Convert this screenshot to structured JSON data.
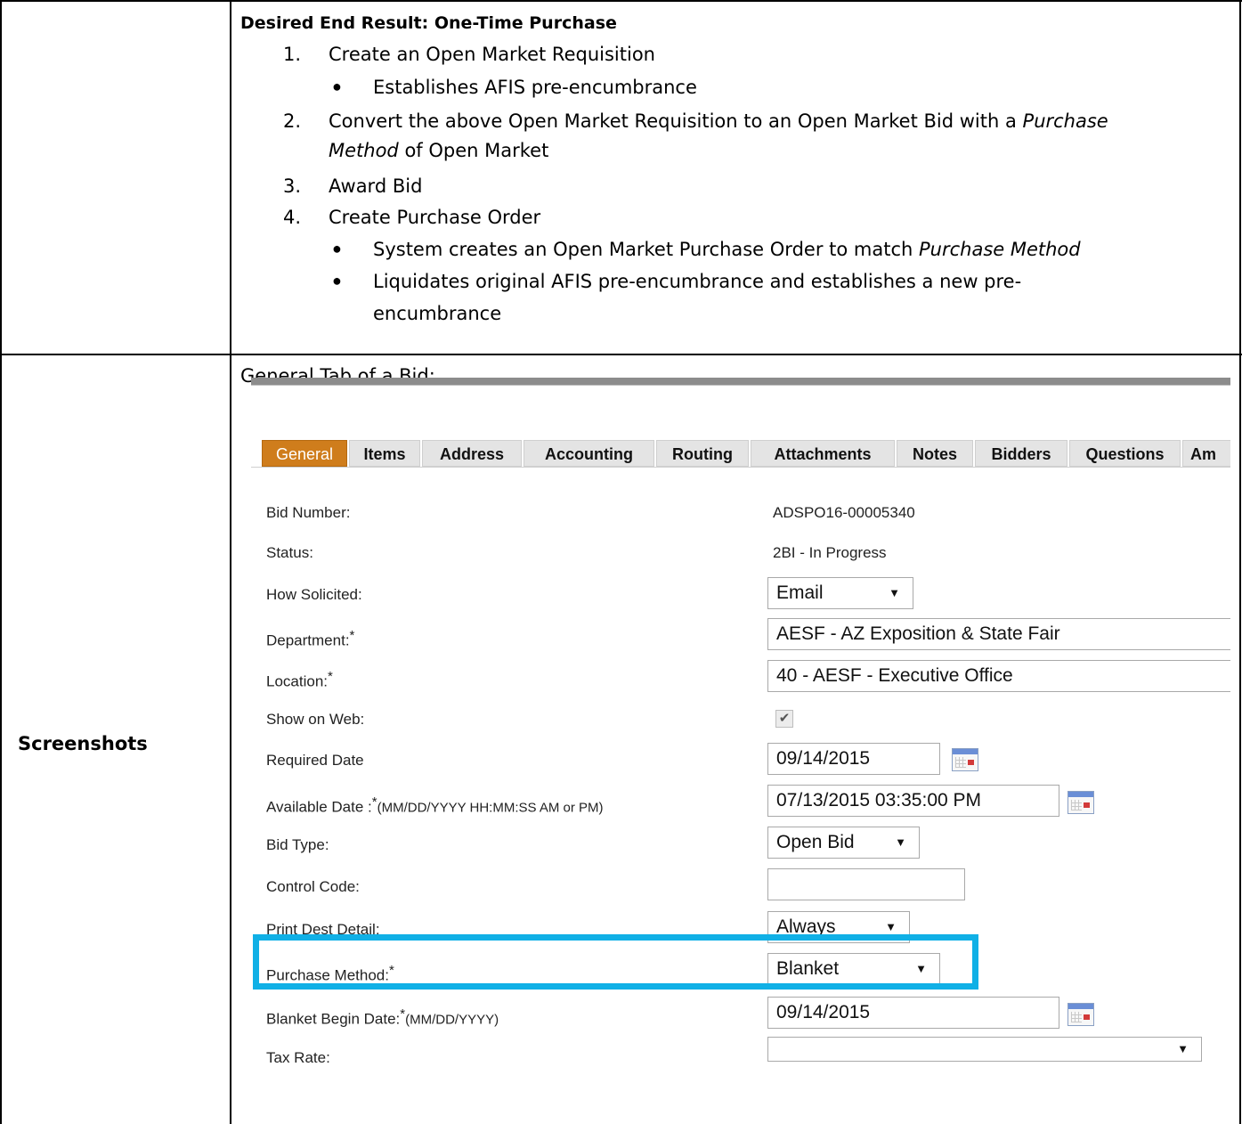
{
  "row1": {
    "heading": "Desired End Result: One-Time Purchase",
    "steps": [
      {
        "num": "1.",
        "text": "Create an Open Market Requisition"
      },
      {
        "num": "2.",
        "text_a": "Convert the above Open Market Requisition to an Open Market Bid with a ",
        "text_a_italic": "Purchase",
        "text_b_italic": "Method",
        "text_b": " of Open Market"
      },
      {
        "num": "3.",
        "text": "Award Bid"
      },
      {
        "num": "4.",
        "text": "Create Purchase Order"
      }
    ],
    "step1_bullet": "Establishes AFIS pre-encumbrance",
    "step4_bullets": [
      {
        "text": "System creates an Open Market Purchase Order to match ",
        "italic": "Purchase Method"
      },
      {
        "text": "Liquidates original AFIS pre-encumbrance and establishes a new pre-",
        "text2": "encumbrance"
      }
    ]
  },
  "row2": {
    "label": "Screenshots",
    "caption": "General Tab of a Bid:"
  },
  "app": {
    "tabs": [
      "General",
      "Items",
      "Address",
      "Accounting",
      "Routing",
      "Attachments",
      "Notes",
      "Bidders",
      "Questions",
      "Am"
    ],
    "fields": {
      "bid_number": {
        "label": "Bid Number:",
        "value": "ADSPO16-00005340"
      },
      "status": {
        "label": "Status:",
        "value": "2BI - In Progress"
      },
      "how_solicited": {
        "label": "How Solicited:",
        "value": "Email"
      },
      "department": {
        "label": "Department:",
        "req": "*",
        "value": "AESF - AZ Exposition & State Fair"
      },
      "location": {
        "label": "Location:",
        "req": "*",
        "value": "40 - AESF - Executive Office"
      },
      "show_on_web": {
        "label": "Show on Web:",
        "checked": true
      },
      "required_date": {
        "label": "Required Date",
        "value": "09/14/2015"
      },
      "available_date": {
        "label": "Available Date :",
        "req": "*",
        "hint": "(MM/DD/YYYY HH:MM:SS AM or PM)",
        "value": "07/13/2015 03:35:00 PM"
      },
      "bid_type": {
        "label": "Bid Type:",
        "value": "Open Bid"
      },
      "control_code": {
        "label": "Control Code:",
        "value": ""
      },
      "print_dest": {
        "label": "Print Dest Detail:",
        "value": "Always"
      },
      "purchase_method": {
        "label": "Purchase Method:",
        "req": "*",
        "value": "Blanket"
      },
      "blanket_begin": {
        "label": "Blanket Begin Date:",
        "req": "*",
        "hint": "(MM/DD/YYYY)",
        "value": "09/14/2015"
      },
      "tax_rate": {
        "label": "Tax Rate:",
        "value": ""
      }
    },
    "caret": "▼",
    "checkmark": "✔",
    "highlight_color": "#10b0e6",
    "active_tab_color": "#cf7d1c"
  }
}
